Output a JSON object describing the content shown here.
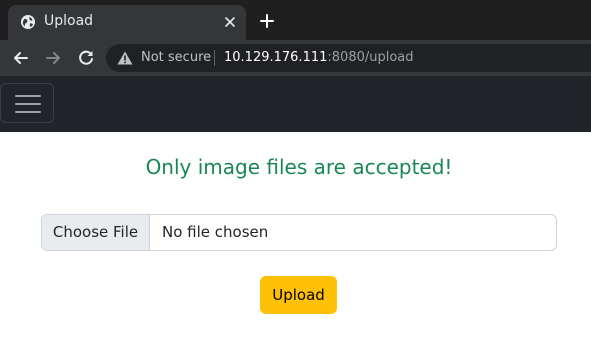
{
  "browser": {
    "tab_title": "Upload",
    "security_label": "Not secure",
    "url_host": "10.129.176.111",
    "url_rest": ":8080/upload"
  },
  "icons": {
    "tab": "globe-icon",
    "close": "close-icon",
    "new_tab": "plus-icon",
    "back": "arrow-left-icon",
    "forward": "arrow-right-icon",
    "reload": "reload-icon",
    "warning": "warning-icon",
    "menu": "hamburger-menu-icon"
  },
  "page": {
    "message": "Only image files are accepted!",
    "file_button_label": "Choose File",
    "file_status": "No file chosen",
    "upload_label": "Upload"
  },
  "colors": {
    "message": "#198754",
    "upload_button": "#ffc107",
    "navbar": "#212529"
  }
}
